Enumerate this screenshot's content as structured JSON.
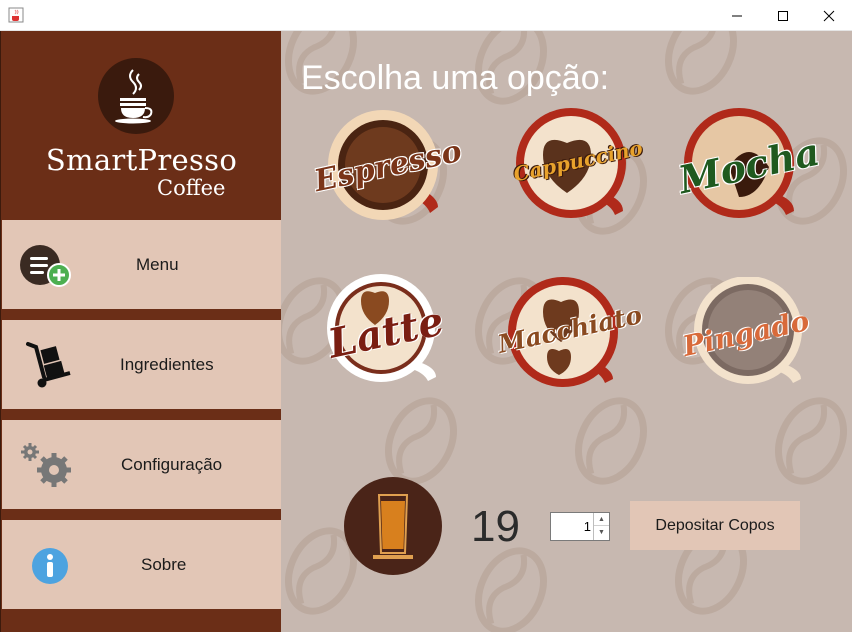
{
  "window": {
    "icon": "java-cup-icon"
  },
  "sidebar": {
    "brand": {
      "name": "SmartPresso",
      "sub": "Coffee",
      "icon": "coffee-cup-icon"
    },
    "items": [
      {
        "label": "Menu",
        "icon": "menu-add-icon"
      },
      {
        "label": "Ingredientes",
        "icon": "hand-truck-icon"
      },
      {
        "label": "Configuração",
        "icon": "gears-icon"
      },
      {
        "label": "Sobre",
        "icon": "info-icon"
      }
    ]
  },
  "main": {
    "heading": "Escolha uma opção:",
    "options": [
      {
        "label": "Espresso",
        "color": "#6b2e17"
      },
      {
        "label": "Cappuccino",
        "color": "#e0a030"
      },
      {
        "label": "Mocha",
        "color": "#1e5a1e"
      },
      {
        "label": "Latte",
        "color": "#7a1e12"
      },
      {
        "label": "Macchiato",
        "color": "#8a4a20"
      },
      {
        "label": "Pingado",
        "color": "#d86a3a"
      }
    ],
    "cups": {
      "count": "19",
      "quantity": "1",
      "deposit_label": "Depositar Copos"
    }
  },
  "colors": {
    "sidebar": "#6b2e17",
    "button": "#e2c6b6",
    "background": "#c7b8b0"
  }
}
